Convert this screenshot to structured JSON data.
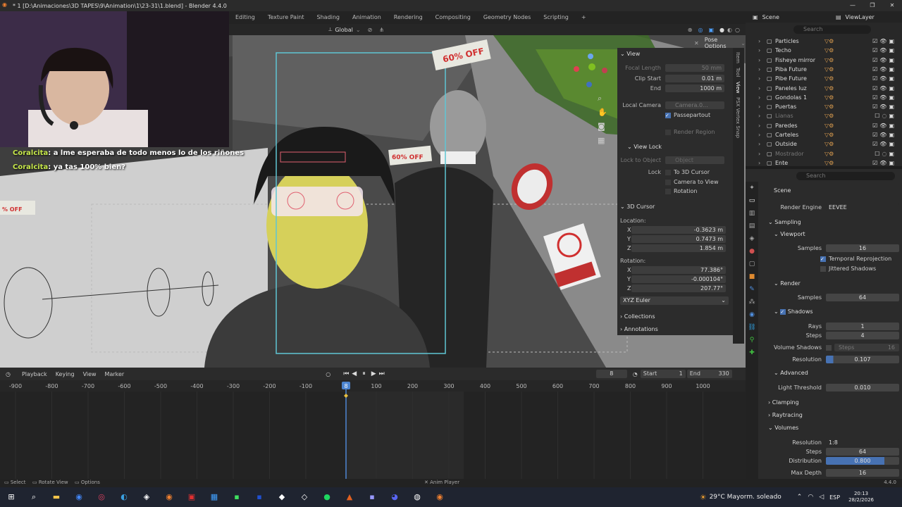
{
  "window": {
    "title": "* 1 [D:\\Animaciones\\3D TAPES\\9\\Animation\\1\\23-31\\1.blend] - Blender 4.4.0",
    "controls": [
      "—",
      "❐",
      "✕"
    ]
  },
  "menubar": {
    "workspaces": [
      "Editing",
      "Texture Paint",
      "Shading",
      "Animation",
      "Rendering",
      "Compositing",
      "Geometry Nodes",
      "Scripting",
      "+"
    ]
  },
  "viewport_header": {
    "orientation": "Global",
    "pose_options": "Pose Options"
  },
  "scene_selector": {
    "scene": "Scene",
    "view_layer": "ViewLayer"
  },
  "chat": [
    {
      "user": "Coralcita",
      "text": "a lme esperaba de todo menos lo de los riñones"
    },
    {
      "user": "Coralcita",
      "text": "ya tas 100% bien?"
    }
  ],
  "npanel": {
    "view": {
      "header": "View",
      "focal_label": "Focal Length",
      "focal": "50 mm",
      "clip_start_label": "Clip Start",
      "clip_start": "0.01 m",
      "end_label": "End",
      "end": "1000 m",
      "local_camera_label": "Local Camera",
      "local_camera": "Camera.0...",
      "passepartout": "Passepartout",
      "render_region": "Render Region"
    },
    "view_lock": {
      "header": "View Lock",
      "lock_to_object": "Lock to Object",
      "object": "Object",
      "lock": "Lock",
      "to_3d_cursor": "To 3D Cursor",
      "camera_to_view": "Camera to View",
      "rotation": "Rotation"
    },
    "cursor": {
      "header": "3D Cursor",
      "location": "Location:",
      "lx": "-0.3623 m",
      "ly": "0.7473 m",
      "lz": "1.854 m",
      "rotation": "Rotation:",
      "rx": "77.386°",
      "ry": "-0.000104°",
      "rz": "207.77°",
      "mode": "XYZ Euler",
      "x": "X",
      "y": "Y",
      "z": "Z"
    },
    "collections": "Collections",
    "annotations": "Annotations",
    "tabs": [
      "Item",
      "Tool",
      "View",
      "PSX Vertex Snap"
    ]
  },
  "outliner": {
    "search": "Search",
    "items": [
      {
        "name": "Particles",
        "vis": true
      },
      {
        "name": "Techo",
        "vis": true
      },
      {
        "name": "Fisheye mirror",
        "vis": true
      },
      {
        "name": "Piba Future",
        "vis": true
      },
      {
        "name": "Pibe Future",
        "vis": true
      },
      {
        "name": "Paneles luz",
        "vis": true
      },
      {
        "name": "Gondolas 1",
        "vis": true
      },
      {
        "name": "Puertas",
        "vis": true
      },
      {
        "name": "Lianas",
        "vis": false
      },
      {
        "name": "Paredes",
        "vis": true
      },
      {
        "name": "Carteles",
        "vis": true
      },
      {
        "name": "Outside",
        "vis": true
      },
      {
        "name": "Mostrador",
        "vis": false
      },
      {
        "name": "Ente",
        "vis": true
      }
    ]
  },
  "properties": {
    "search": "Search",
    "scene": "Scene",
    "render_engine_label": "Render Engine",
    "render_engine": "EEVEE",
    "sampling": "Sampling",
    "viewport": "Viewport",
    "samples_label": "Samples",
    "viewport_samples": "16",
    "temporal_reprojection": "Temporal Reprojection",
    "jittered_shadows": "Jittered Shadows",
    "render": "Render",
    "render_samples": "64",
    "shadows": "Shadows",
    "rays_label": "Rays",
    "rays": "1",
    "steps_label": "Steps",
    "steps": "4",
    "volume_shadows_label": "Volume Shadows",
    "volume_steps_label": "Steps",
    "volume_steps": "16",
    "resolution_label": "Resolution",
    "resolution": "0.107",
    "advanced": "Advanced",
    "light_threshold_label": "Light Threshold",
    "light_threshold": "0.010",
    "clamping": "Clamping",
    "raytracing": "Raytracing",
    "volumes": "Volumes",
    "vol_resolution": "1:8",
    "vol_steps": "64",
    "distribution_label": "Distribution",
    "distribution": "0.800",
    "max_depth_label": "Max Depth",
    "max_depth": "16"
  },
  "timeline": {
    "menus": [
      "Playback",
      "Keying",
      "View",
      "Marker"
    ],
    "frame": "8",
    "start_label": "Start",
    "start": "1",
    "end_label": "End",
    "end": "330",
    "ticks": [
      "-900",
      "-800",
      "-700",
      "-600",
      "-500",
      "-400",
      "-300",
      "-200",
      "-100",
      "8",
      "100",
      "200",
      "300",
      "400",
      "500",
      "600",
      "700",
      "800",
      "900",
      "1000"
    ]
  },
  "statusbar": {
    "select": "Select",
    "rotate_view": "Rotate View",
    "options": "Options",
    "anim_player": "Anim Player",
    "version": "4.4.0"
  },
  "taskbar": {
    "weather": "29°C  Mayorm. soleado",
    "lang": "ESP",
    "time": "20:13",
    "date": "28/2/2026"
  },
  "colors": {
    "accent": "#4772b3",
    "cam_frame": "#5fc6d4",
    "playhead": "#4d85d1"
  }
}
